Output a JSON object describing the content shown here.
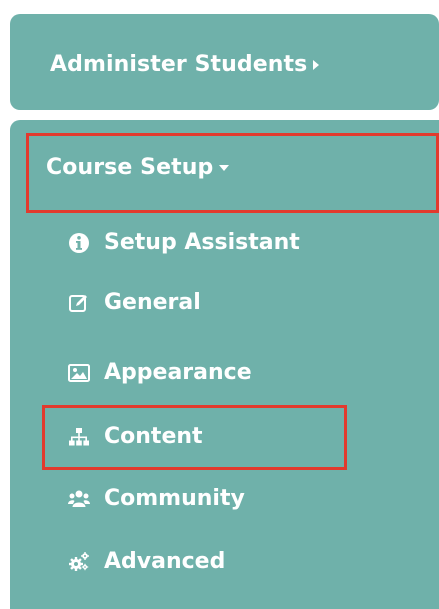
{
  "menu": {
    "administer_students": {
      "label": "Administer Students",
      "icon": "caret-right-icon"
    },
    "course_setup": {
      "label": "Course Setup",
      "icon": "caret-down-icon",
      "items": [
        {
          "label": "Setup Assistant",
          "icon": "info-circle-icon"
        },
        {
          "label": "General",
          "icon": "edit-icon"
        },
        {
          "label": "Appearance",
          "icon": "image-icon"
        },
        {
          "label": "Content",
          "icon": "sitemap-icon"
        },
        {
          "label": "Community",
          "icon": "users-icon"
        },
        {
          "label": "Advanced",
          "icon": "cogs-icon"
        }
      ]
    }
  },
  "colors": {
    "panel_background": "#6fb1aa",
    "text": "#ffffff",
    "highlight_border": "#e23a2e"
  }
}
